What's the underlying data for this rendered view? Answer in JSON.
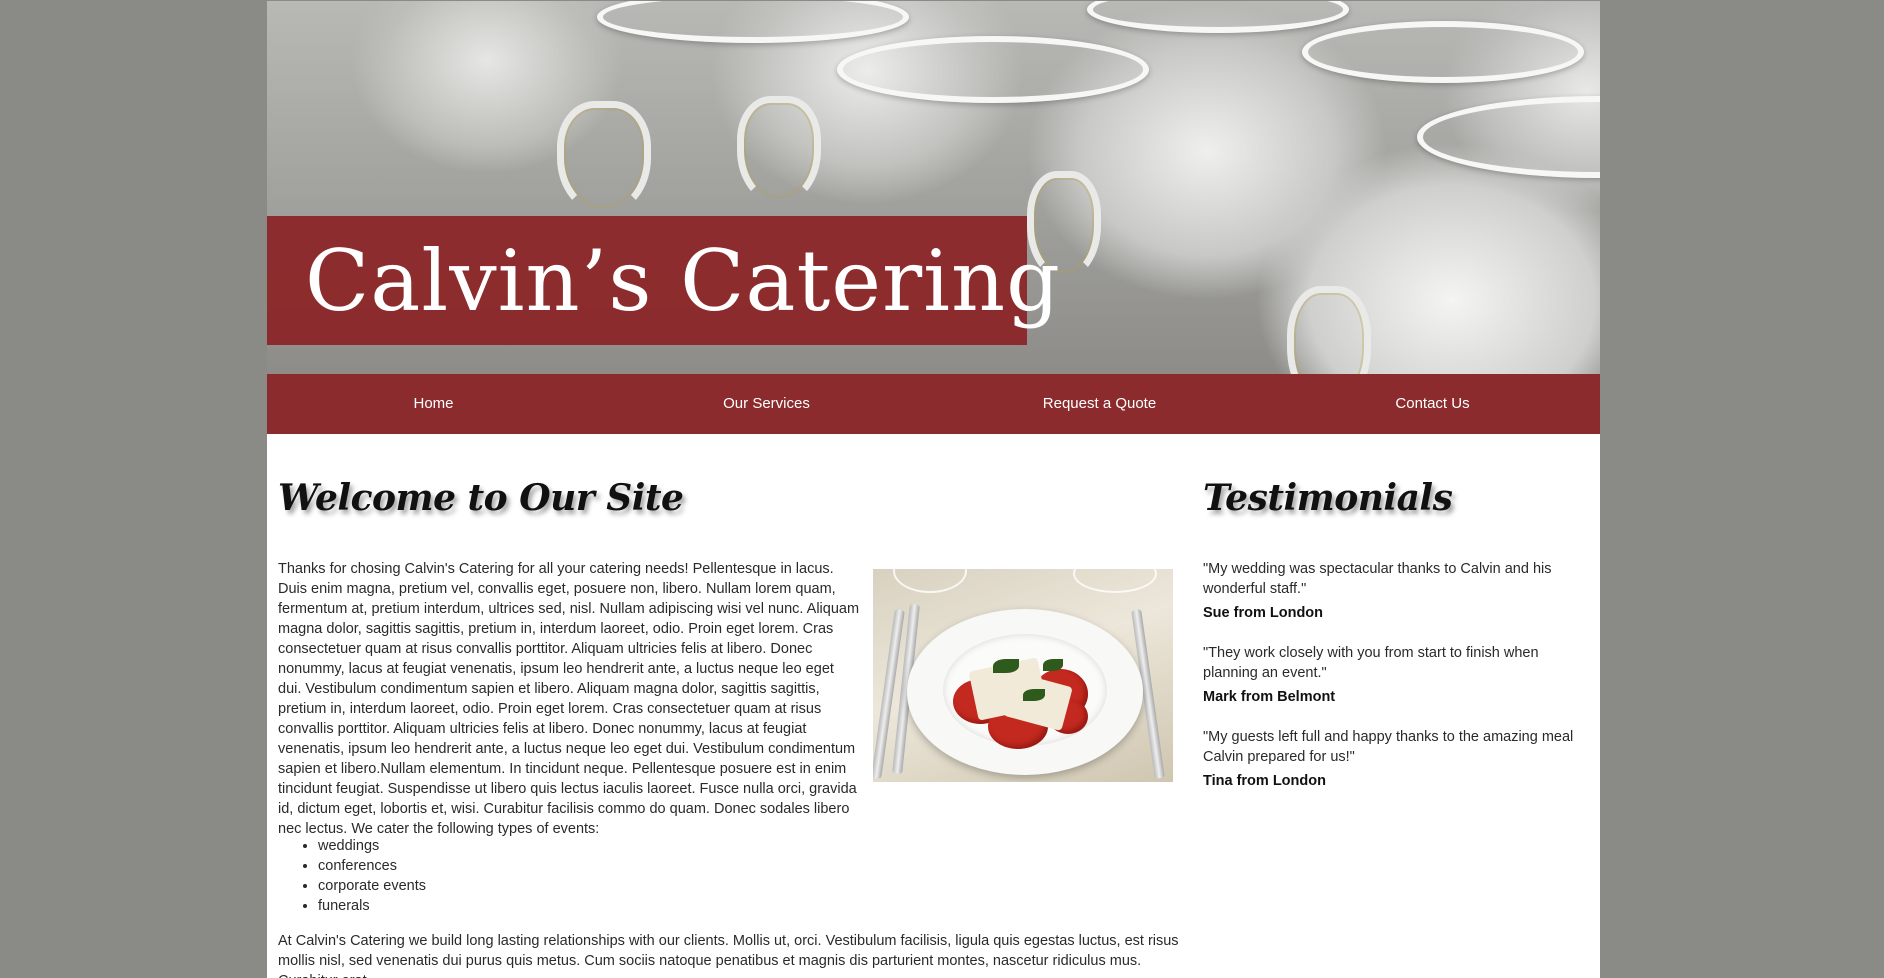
{
  "site": {
    "title": "Calvin’s Catering"
  },
  "nav": {
    "items": [
      {
        "label": "Home"
      },
      {
        "label": "Our Services"
      },
      {
        "label": "Request a Quote"
      },
      {
        "label": "Contact Us"
      }
    ]
  },
  "main": {
    "heading": "Welcome to Our Site",
    "intro": "Thanks for chosing Calvin's Catering for all your catering needs! Pellentesque in lacus. Duis enim magna, pretium vel, convallis eget, posuere non, libero. Nullam lorem quam, fermentum at, pretium interdum, ultrices sed, nisl. Nullam adipiscing wisi vel nunc. Aliquam magna dolor, sagittis sagittis, pretium in, interdum laoreet, odio. Proin eget lorem. Cras consectetuer quam at risus convallis porttitor. Aliquam ultricies felis at libero. Donec nonummy, lacus at feugiat venenatis, ipsum leo hendrerit ante, a luctus neque leo eget dui. Vestibulum condimentum sapien et libero. Aliquam magna dolor, sagittis sagittis, pretium in, interdum laoreet, odio. Proin eget lorem. Cras consectetuer quam at risus convallis porttitor. Aliquam ultricies felis at libero. Donec nonummy, lacus at feugiat venenatis, ipsum leo hendrerit ante, a luctus neque leo eget dui. Vestibulum condimentum sapien et libero.Nullam elementum. In tincidunt neque. Pellentesque posuere est in enim tincidunt feugiat. Suspendisse ut libero quis lectus iaculis laoreet. Fusce nulla orci, gravida id, dictum eget, lobortis et, wisi. Curabitur facilisis commo do quam. Donec sodales libero nec lectus. We cater the following types of events:",
    "events": [
      "weddings",
      "conferences",
      "corporate events",
      "funerals"
    ],
    "closing": "At Calvin's Catering we build long lasting relationships with our clients. Mollis ut, orci. Vestibulum facilisis, ligula quis egestas luctus, est risus mollis nisl, sed venenatis dui purus quis metus. Cum sociis natoque penatibus et magnis dis parturient montes, nascetur ridiculus mus. Curabitur erat."
  },
  "sidebar": {
    "heading": "Testimonials",
    "testimonials": [
      {
        "quote": "\"My wedding was spectacular thanks to Calvin and his wonderful staff.\"",
        "author": "Sue from London"
      },
      {
        "quote": "\"They work closely with you from start to finish when planning an event.\"",
        "author": "Mark from Belmont"
      },
      {
        "quote": "\"My guests left full and happy thanks to the amazing meal Calvin prepared for us!\"",
        "author": "Tina from London"
      }
    ]
  },
  "colors": {
    "brand_red": "#8b2b2d",
    "page_background": "#8a8a86",
    "content_background": "#ffffff"
  },
  "images": {
    "hero": "cups-photo",
    "food": "salad-plate-photo"
  }
}
